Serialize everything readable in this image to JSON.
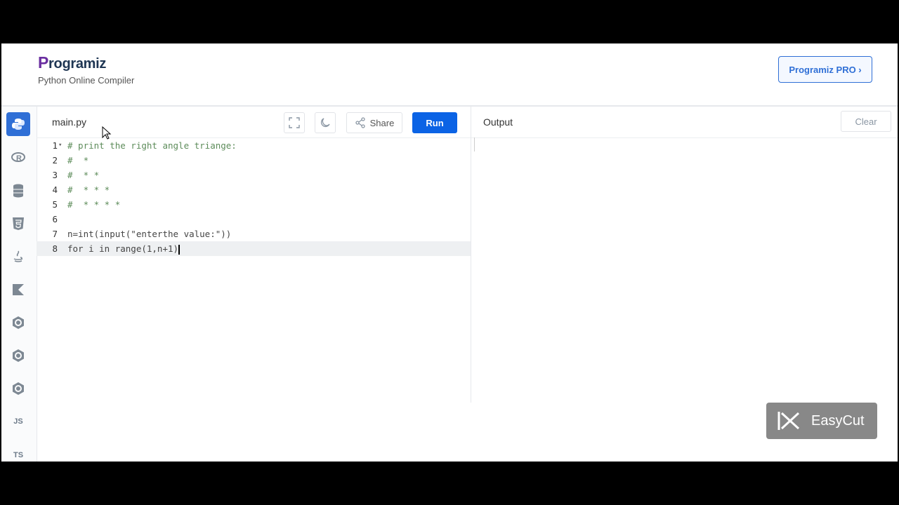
{
  "header": {
    "logo_first": "P",
    "logo_rest": "rogramiz",
    "subtitle": "Python Online Compiler",
    "pro_button": "Programiz PRO ›"
  },
  "sidebar": {
    "items": [
      {
        "name": "python-icon",
        "label": ""
      },
      {
        "name": "r-icon",
        "label": ""
      },
      {
        "name": "sql-icon",
        "label": ""
      },
      {
        "name": "html-icon",
        "label": ""
      },
      {
        "name": "java-icon",
        "label": ""
      },
      {
        "name": "kotlin-icon",
        "label": ""
      },
      {
        "name": "c-icon",
        "label": ""
      },
      {
        "name": "cpp-icon",
        "label": ""
      },
      {
        "name": "csharp-icon",
        "label": ""
      },
      {
        "name": "js-icon",
        "label": "JS"
      },
      {
        "name": "ts-icon",
        "label": "TS"
      }
    ]
  },
  "editor": {
    "file_name": "main.py",
    "share_label": "Share",
    "run_label": "Run",
    "lines": [
      {
        "num": "1",
        "text": "# print the right angle triange:",
        "type": "comment",
        "fold": "▾"
      },
      {
        "num": "2",
        "text": "#  *",
        "type": "comment"
      },
      {
        "num": "3",
        "text": "#  * *",
        "type": "comment"
      },
      {
        "num": "4",
        "text": "#  * * *",
        "type": "comment"
      },
      {
        "num": "5",
        "text": "#  * * * *",
        "type": "comment"
      },
      {
        "num": "6",
        "text": "",
        "type": "plain"
      },
      {
        "num": "7",
        "text": "n=int(input(\"enterthe value:\"))",
        "type": "plain"
      },
      {
        "num": "8",
        "text": "for i in range(1,n+1)",
        "type": "plain"
      }
    ]
  },
  "output": {
    "title": "Output",
    "clear_label": "Clear"
  },
  "watermark": {
    "text": "EasyCut"
  },
  "colors": {
    "accent": "#0b63e5",
    "pro_border": "#2f6fd6",
    "comment": "#5d8c5a"
  }
}
